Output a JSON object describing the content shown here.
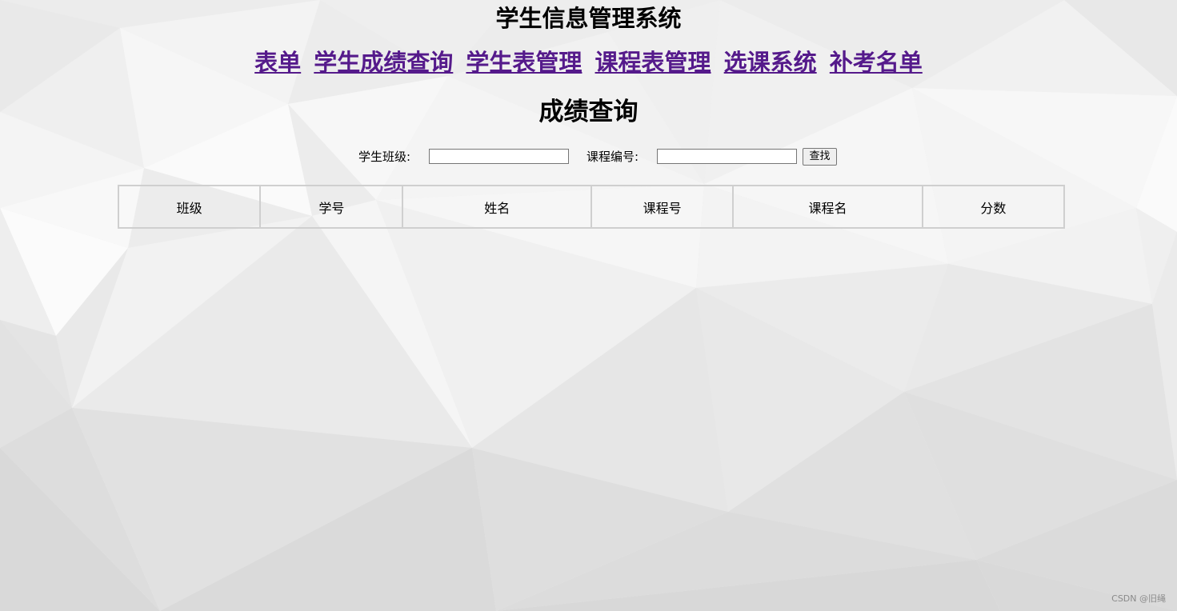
{
  "app": {
    "title": "学生信息管理系统"
  },
  "nav": {
    "items": [
      {
        "label": "表单"
      },
      {
        "label": "学生成绩查询"
      },
      {
        "label": "学生表管理"
      },
      {
        "label": "课程表管理"
      },
      {
        "label": "选课系统"
      },
      {
        "label": "补考名单"
      }
    ],
    "link_color": "#551a8b"
  },
  "page": {
    "heading": "成绩查询"
  },
  "search": {
    "class_label": "学生班级:",
    "class_value": "",
    "course_label": "课程编号:",
    "course_value": "",
    "button_label": "查找"
  },
  "table": {
    "headers": [
      "班级",
      "学号",
      "姓名",
      "课程号",
      "课程名",
      "分数"
    ],
    "rows": []
  },
  "watermark": "CSDN @旧绳"
}
